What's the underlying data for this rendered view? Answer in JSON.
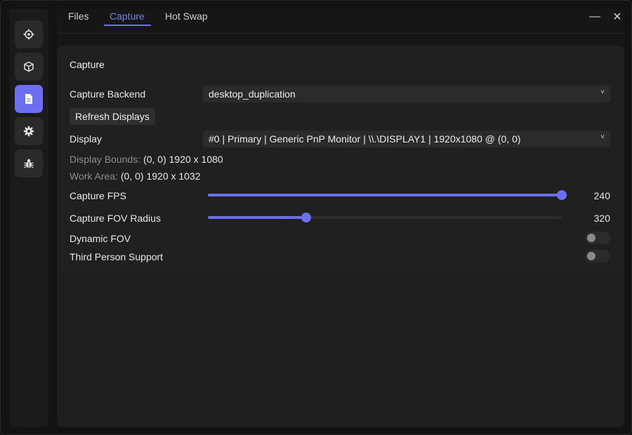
{
  "tabs": [
    {
      "label": "Files"
    },
    {
      "label": "Capture"
    },
    {
      "label": "Hot Swap"
    }
  ],
  "window_controls": {
    "minimize": "—",
    "close": "✕"
  },
  "sidebar": {
    "items": [
      {
        "icon": "crosshair-icon"
      },
      {
        "icon": "cube-icon"
      },
      {
        "icon": "document-icon",
        "active": true
      },
      {
        "icon": "gear-icon"
      },
      {
        "icon": "bug-icon"
      }
    ]
  },
  "capture": {
    "title": "Capture",
    "backend_label": "Capture Backend",
    "backend_value": "desktop_duplication",
    "refresh_label": "Refresh Displays",
    "display_label": "Display",
    "display_value": "#0 | Primary | Generic PnP Monitor | \\\\.\\DISPLAY1 | 1920x1080 @ (0, 0)",
    "bounds_key": "Display Bounds:",
    "bounds_value": "(0, 0) 1920 x 1080",
    "work_key": "Work Area:",
    "work_value": "(0, 0) 1920 x 1032",
    "fps_label": "Capture FPS",
    "fps_value": "240",
    "fps_fraction": 1.0,
    "fov_label": "Capture FOV Radius",
    "fov_value": "320",
    "fov_fraction": 0.278,
    "dynamic_fov_label": "Dynamic FOV",
    "dynamic_fov_on": false,
    "third_person_label": "Third Person Support",
    "third_person_on": false
  },
  "colors": {
    "accent": "#6b6ff0",
    "background": "#131313",
    "panel": "#202020"
  }
}
